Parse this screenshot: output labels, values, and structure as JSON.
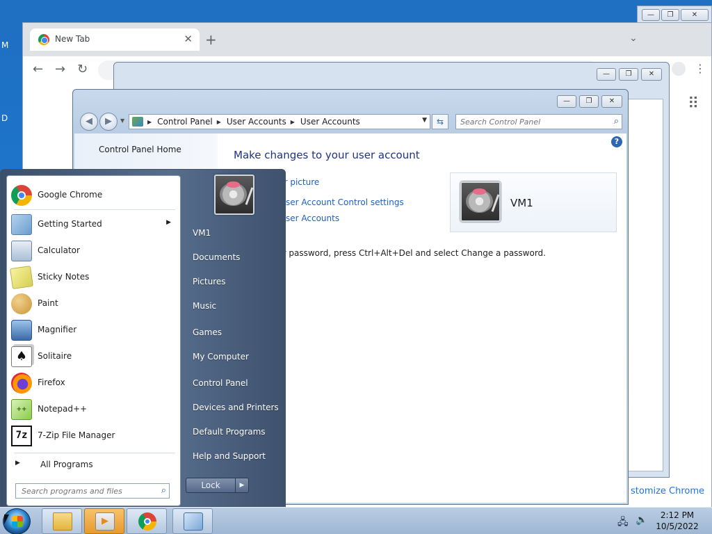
{
  "desktop": {
    "edge_letters": [
      "M",
      "D"
    ]
  },
  "chrome": {
    "tab_title": "New Tab",
    "tab_close_glyph": "✕",
    "new_tab_glyph": "+",
    "tab_list_glyph": "⌄",
    "back_glyph": "←",
    "forward_glyph": "→",
    "reload_glyph": "↻",
    "apps_glyph": "⠿",
    "menu_glyph": "⋮",
    "customize_label": "stomize Chrome"
  },
  "control_panel": {
    "breadcrumbs": [
      "Control Panel",
      "User Accounts",
      "User Accounts"
    ],
    "search_placeholder": "Search Control Panel",
    "home_link": "Control Panel Home",
    "heading": "Make changes to your user account",
    "links": [
      "ur picture",
      "ser Account Control settings",
      "ser Accounts"
    ],
    "password_note": "ur password, press Ctrl+Alt+Del and select Change a password.",
    "user_name": "VM1",
    "help_glyph": "?"
  },
  "start_menu": {
    "programs": [
      {
        "label": "Google Chrome",
        "icon": "chrome-icon"
      },
      {
        "label": "Getting Started",
        "icon": "getting-started-icon",
        "has_submenu": true
      },
      {
        "label": "Calculator",
        "icon": "calculator-icon"
      },
      {
        "label": "Sticky Notes",
        "icon": "sticky-notes-icon"
      },
      {
        "label": "Paint",
        "icon": "paint-icon"
      },
      {
        "label": "Magnifier",
        "icon": "magnifier-icon"
      },
      {
        "label": "Solitaire",
        "icon": "solitaire-icon"
      },
      {
        "label": "Firefox",
        "icon": "firefox-icon"
      },
      {
        "label": "Notepad++",
        "icon": "notepad-plus-plus-icon"
      },
      {
        "label": "7-Zip File Manager",
        "icon": "seven-zip-icon"
      }
    ],
    "all_programs": "All Programs",
    "search_placeholder": "Search programs and files",
    "right_items": [
      "VM1",
      "Documents",
      "Pictures",
      "Music",
      "Games",
      "My Computer",
      "Control Panel",
      "Devices and Printers",
      "Default Programs",
      "Help and Support"
    ],
    "lock_label": "Lock"
  },
  "taskbar": {
    "apps": [
      "windows-explorer-icon",
      "media-player-icon",
      "chrome-icon",
      "control-panel-icon"
    ],
    "clock_time": "2:12 PM",
    "clock_date": "10/5/2022"
  },
  "colors": {
    "link": "#1e5fbb",
    "heading": "#1e3287",
    "desktop": "#1f6fc2"
  }
}
